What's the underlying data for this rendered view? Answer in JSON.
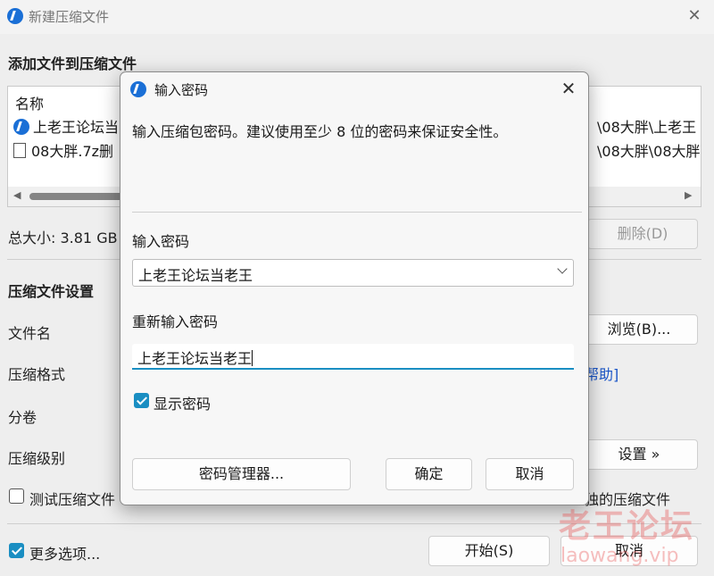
{
  "parent": {
    "title": "新建压缩文件",
    "section_add": "添加文件到压缩文件",
    "list": {
      "column_name": "名称",
      "rows": [
        {
          "name": "上老王论坛当",
          "path": "\\08大胖\\上老王"
        },
        {
          "name": "08大胖.7z删",
          "path": "\\08大胖\\08大胖"
        }
      ]
    },
    "total_size": "总大小: 3.81 GB",
    "delete_button": "删除(D)",
    "section_settings": "压缩文件设置",
    "label_filename": "文件名",
    "browse_button": "浏览(B)...",
    "label_format": "压缩格式",
    "help_link": "帮助]",
    "label_split": "分卷",
    "label_level": "压缩级别",
    "advanced_button": "设置 »",
    "test_checkbox": "测试压缩文件",
    "separate_checkbox": "独的压缩文件",
    "more_options": "更多选项...",
    "start_button": "开始(S)",
    "cancel_button": "取消"
  },
  "dialog": {
    "title": "输入密码",
    "message": "输入压缩包密码。建议使用至少 8 位的密码来保证安全性。",
    "label_password": "输入密码",
    "password_value": "上老王论坛当老王",
    "label_reenter": "重新输入密码",
    "reenter_value": "上老王论坛当老王",
    "show_password": "显示密码",
    "show_password_checked": true,
    "manager_button": "密码管理器...",
    "ok_button": "确定",
    "cancel_button": "取消"
  },
  "watermark": {
    "text": "老王论坛",
    "url": "laowang.vip"
  },
  "colors": {
    "accent": "#1a8ec2",
    "link": "#1a55c7",
    "app_icon": "#1a6fd6"
  },
  "icons": {
    "app": "app-bolt-icon",
    "close": "close-icon",
    "file": "file-icon",
    "dropdown": "chevron-down-icon"
  }
}
